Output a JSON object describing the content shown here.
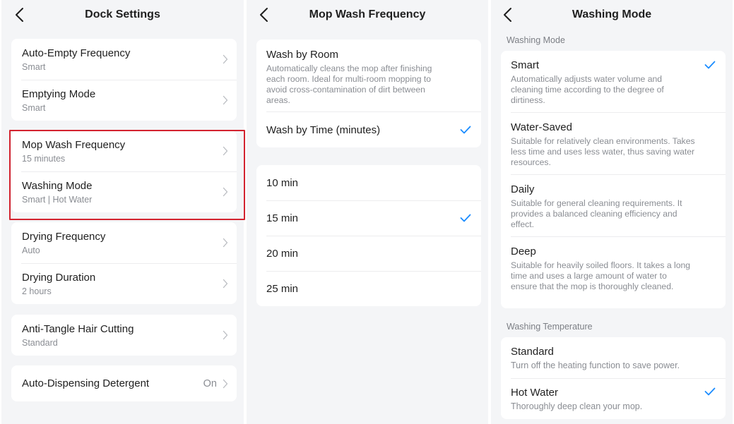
{
  "dock": {
    "title": "Dock Settings",
    "items": [
      {
        "label": "Auto-Empty Frequency",
        "value": "Smart"
      },
      {
        "label": "Emptying Mode",
        "value": "Smart"
      },
      {
        "label": "Mop Wash Frequency",
        "value": "15 minutes"
      },
      {
        "label": "Washing Mode",
        "value": "Smart | Hot Water"
      },
      {
        "label": "Drying Frequency",
        "value": "Auto"
      },
      {
        "label": "Drying Duration",
        "value": "2 hours"
      },
      {
        "label": "Anti-Tangle Hair Cutting",
        "value": "Standard"
      },
      {
        "label": "Auto-Dispensing Detergent",
        "value": "On"
      }
    ]
  },
  "mop": {
    "title": "Mop Wash Frequency",
    "by_room": {
      "label": "Wash by Room",
      "desc": "Automatically cleans the mop after finishing each room. Ideal for multi-room mopping to avoid cross-contamination of dirt between areas."
    },
    "by_time": {
      "label": "Wash by Time (minutes)"
    },
    "options": [
      "10 min",
      "15 min",
      "20 min",
      "25 min"
    ],
    "selected_option": "15 min"
  },
  "washing": {
    "title": "Washing Mode",
    "mode_section": "Washing Mode",
    "modes": [
      {
        "label": "Smart",
        "desc": "Automatically adjusts water volume and cleaning time according to the degree of dirtiness."
      },
      {
        "label": "Water-Saved",
        "desc": "Suitable for relatively clean environments. Takes less time and uses less water, thus saving water resources."
      },
      {
        "label": "Daily",
        "desc": "Suitable for general cleaning requirements. It provides a balanced cleaning efficiency and effect."
      },
      {
        "label": "Deep",
        "desc": "Suitable for heavily soiled floors. It takes a long time and uses a large amount of water to ensure that the mop is thoroughly cleaned."
      }
    ],
    "selected_mode": "Smart",
    "temp_section": "Washing Temperature",
    "temps": [
      {
        "label": "Standard",
        "desc": "Turn off the heating function to save power."
      },
      {
        "label": "Hot Water",
        "desc": "Thoroughly deep clean your mop."
      }
    ],
    "selected_temp": "Hot Water"
  },
  "colors": {
    "accent": "#1a8cff",
    "highlight": "#d3232f",
    "background": "#f4f5f7",
    "card": "#ffffff"
  },
  "icons": {
    "back": "chevron-left-icon",
    "forward": "chevron-right-icon",
    "selected": "checkmark-icon"
  }
}
